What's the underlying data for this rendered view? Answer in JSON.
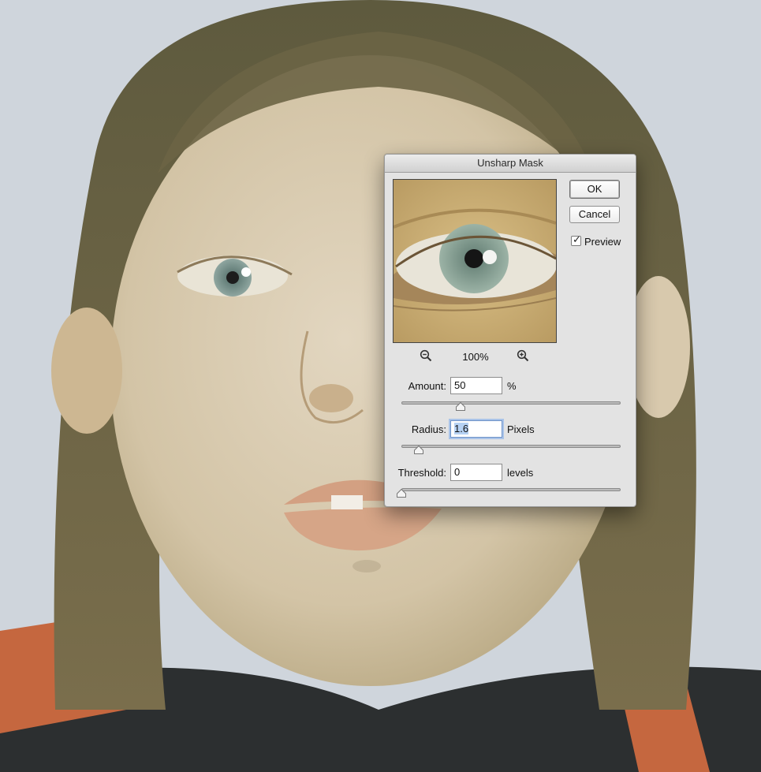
{
  "dialog": {
    "title": "Unsharp Mask",
    "ok_label": "OK",
    "cancel_label": "Cancel",
    "preview_label": "Preview",
    "preview_checked": true,
    "zoom_level": "100%",
    "zoom_out_icon": "zoom-out-icon",
    "zoom_in_icon": "zoom-in-icon"
  },
  "amount": {
    "label": "Amount:",
    "value": "50",
    "unit": "%",
    "slider_fraction": 0.27
  },
  "radius": {
    "label": "Radius:",
    "value": "1.6",
    "unit": "Pixels",
    "slider_fraction": 0.08
  },
  "threshold": {
    "label": "Threshold:",
    "value": "0",
    "unit": "levels",
    "slider_fraction": 0.0
  }
}
